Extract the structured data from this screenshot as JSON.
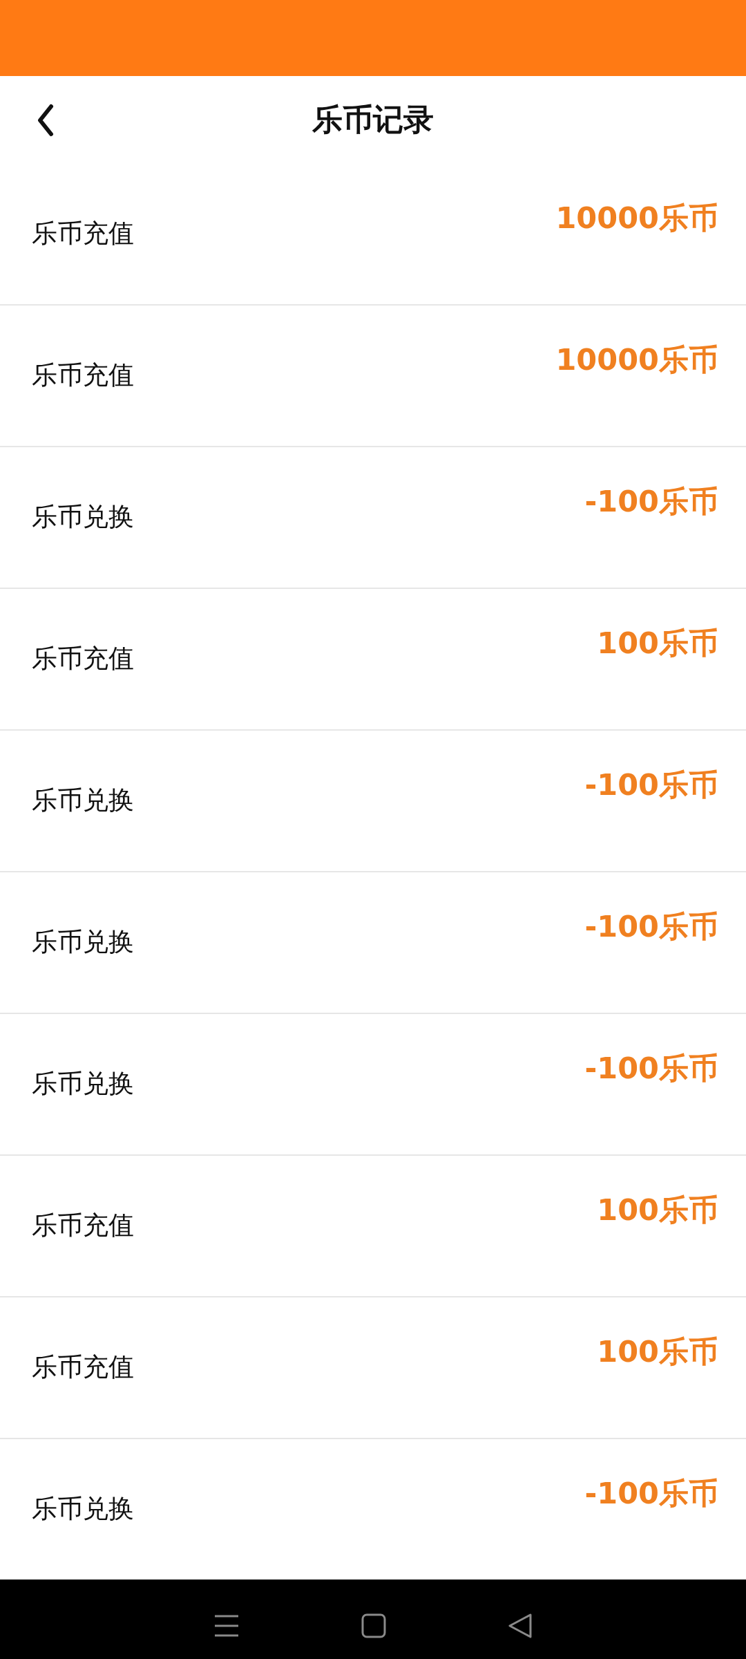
{
  "header": {
    "title": "乐币记录"
  },
  "records": [
    {
      "label": "乐币充值",
      "amount": "10000乐币"
    },
    {
      "label": "乐币充值",
      "amount": "10000乐币"
    },
    {
      "label": "乐币兑换",
      "amount": "-100乐币"
    },
    {
      "label": "乐币充值",
      "amount": "100乐币"
    },
    {
      "label": "乐币兑换",
      "amount": "-100乐币"
    },
    {
      "label": "乐币兑换",
      "amount": "-100乐币"
    },
    {
      "label": "乐币兑换",
      "amount": "-100乐币"
    },
    {
      "label": "乐币充值",
      "amount": "100乐币"
    },
    {
      "label": "乐币充值",
      "amount": "100乐币"
    },
    {
      "label": "乐币兑换",
      "amount": "-100乐币"
    }
  ]
}
